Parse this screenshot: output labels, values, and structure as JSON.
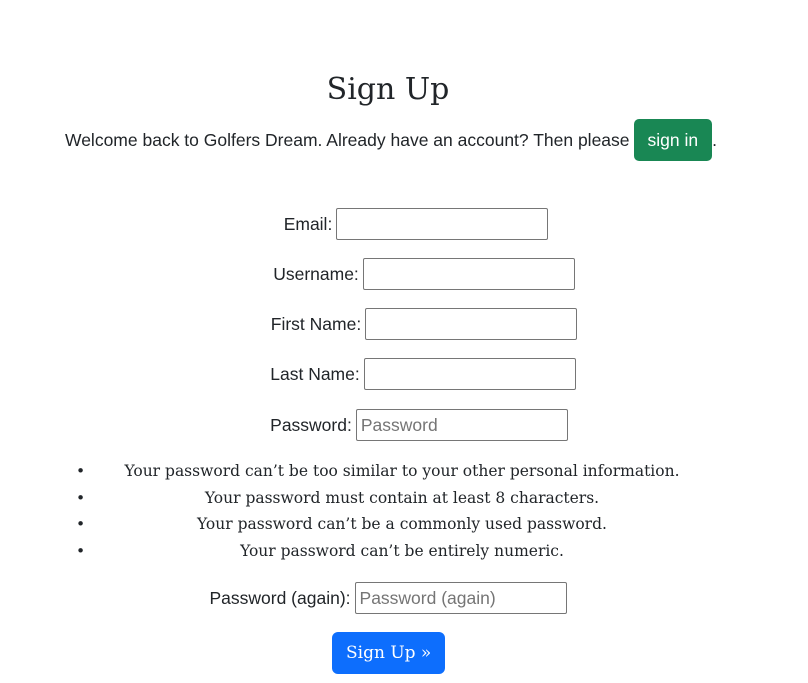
{
  "page": {
    "title": "Sign Up",
    "welcome_text": "Welcome back to Golfers Dream. Already have an account? Then please",
    "signin_label": "sign in",
    "welcome_suffix": "."
  },
  "form": {
    "email": {
      "label": "Email:",
      "value": "",
      "placeholder": ""
    },
    "username": {
      "label": "Username:",
      "value": "",
      "placeholder": ""
    },
    "first_name": {
      "label": "First Name:",
      "value": "",
      "placeholder": ""
    },
    "last_name": {
      "label": "Last Name:",
      "value": "",
      "placeholder": ""
    },
    "password1": {
      "label": "Password:",
      "value": "",
      "placeholder": "Password"
    },
    "password2": {
      "label": "Password (again):",
      "value": "",
      "placeholder": "Password (again)"
    },
    "help": [
      "Your password can’t be too similar to your other personal information.",
      "Your password must contain at least 8 characters.",
      "Your password can’t be a commonly used password.",
      "Your password can’t be entirely numeric."
    ],
    "submit_label": "Sign Up »"
  },
  "colors": {
    "signin_button": "#198754",
    "submit_button": "#0d6efd"
  }
}
